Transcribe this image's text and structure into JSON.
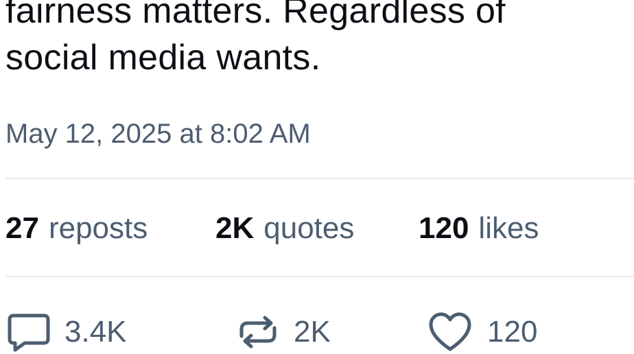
{
  "post": {
    "text_line_1": "fairness matters. Regardless of",
    "text_line_2": "social media wants.",
    "timestamp": "May 12, 2025 at 8:02 AM"
  },
  "stats": {
    "reposts_count": "27",
    "reposts_label": "reposts",
    "quotes_count": "2K",
    "quotes_label": "quotes",
    "likes_count": "120",
    "likes_label": "likes"
  },
  "actions": {
    "reply_count": "3.4K",
    "repost_count": "2K",
    "like_count": "120",
    "reply_icon": "speech-bubble-icon",
    "repost_icon": "repost-arrows-icon",
    "like_icon": "heart-icon"
  },
  "colors": {
    "text": "#0b0f14",
    "secondary": "#4c5d70",
    "divider": "#e4e8ed"
  }
}
